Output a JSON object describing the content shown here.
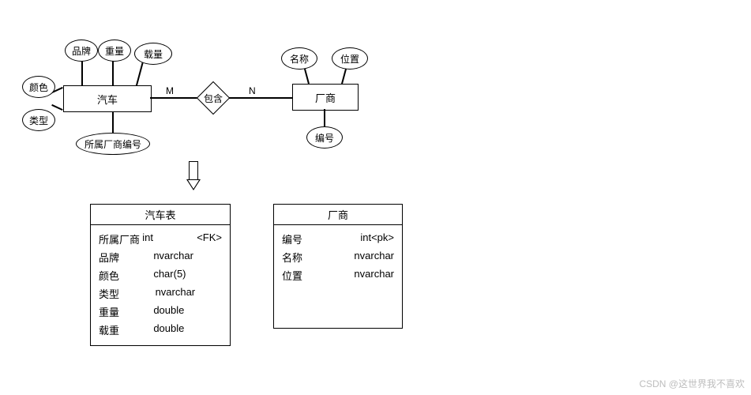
{
  "er": {
    "car_entity": "汽车",
    "vendor_entity": "厂商",
    "relation": "包含",
    "card_left": "M",
    "card_right": "N",
    "car_attrs": {
      "brand": "品牌",
      "weight": "重量",
      "load": "载量",
      "color": "颜色",
      "type": "类型",
      "vendor_fk": "所属厂商编号"
    },
    "vendor_attrs": {
      "name": "名称",
      "location": "位置",
      "id": "编号"
    }
  },
  "tables": {
    "car": {
      "title": "汽车表",
      "rows": [
        {
          "name": "所属厂商",
          "type": "int",
          "note": "<FK>"
        },
        {
          "name": "品牌",
          "type": "nvarchar",
          "note": ""
        },
        {
          "name": "颜色",
          "type": "char(5)",
          "note": ""
        },
        {
          "name": "类型",
          "type": "nvarchar",
          "note": ""
        },
        {
          "name": "重量",
          "type": "double",
          "note": ""
        },
        {
          "name": "载重",
          "type": "double",
          "note": ""
        }
      ]
    },
    "vendor": {
      "title": "厂商",
      "rows": [
        {
          "name": "编号",
          "type": "int<pk>",
          "note": ""
        },
        {
          "name": "名称",
          "type": "nvarchar",
          "note": ""
        },
        {
          "name": "位置",
          "type": "nvarchar",
          "note": ""
        }
      ]
    }
  },
  "watermark": "CSDN @这世界我不喜欢"
}
